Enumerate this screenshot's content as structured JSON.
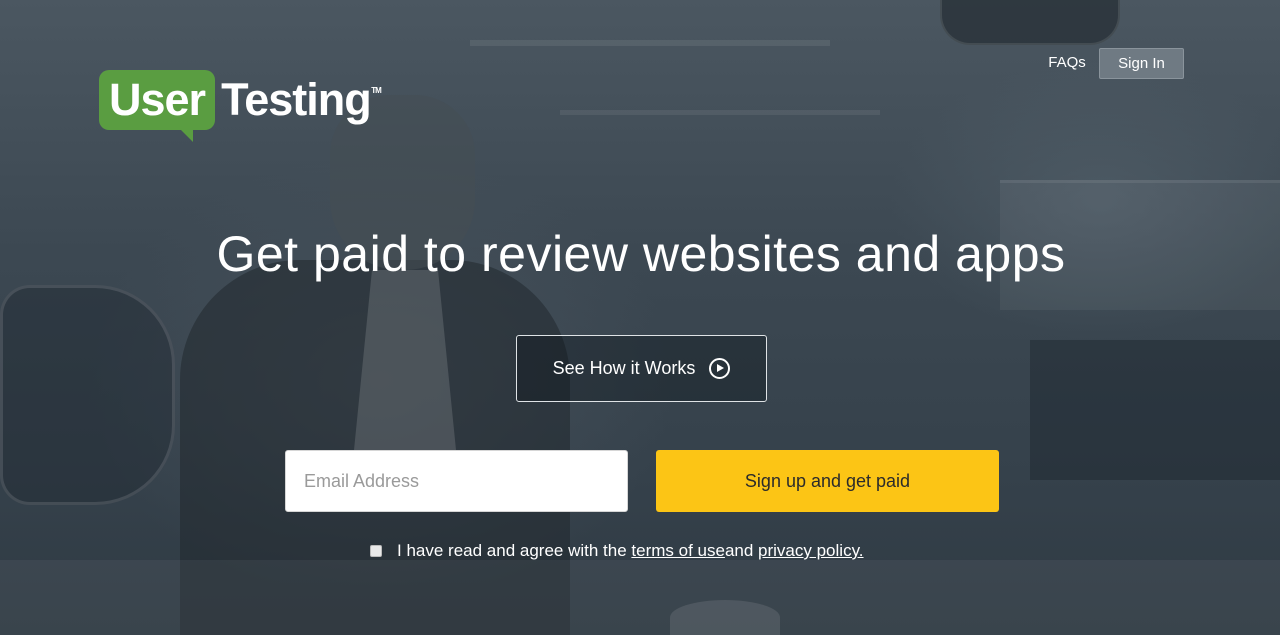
{
  "logo": {
    "part1": "User",
    "part2": "Testing",
    "tm": "TM"
  },
  "nav": {
    "faqs": "FAQs",
    "signin": "Sign In"
  },
  "hero": {
    "headline": "Get paid to review websites and apps",
    "see_how": "See How it Works"
  },
  "form": {
    "email_placeholder": "Email Address",
    "signup_label": "Sign up and get paid"
  },
  "terms": {
    "prefix": "I have read and agree with the ",
    "terms_link": "terms of use ",
    "middle": "and ",
    "privacy_link": "privacy policy."
  },
  "colors": {
    "brand_green": "#5a9d41",
    "cta_yellow": "#fcc515",
    "overlay": "#3c4852"
  },
  "icons": {
    "play": "play-circle-icon"
  }
}
